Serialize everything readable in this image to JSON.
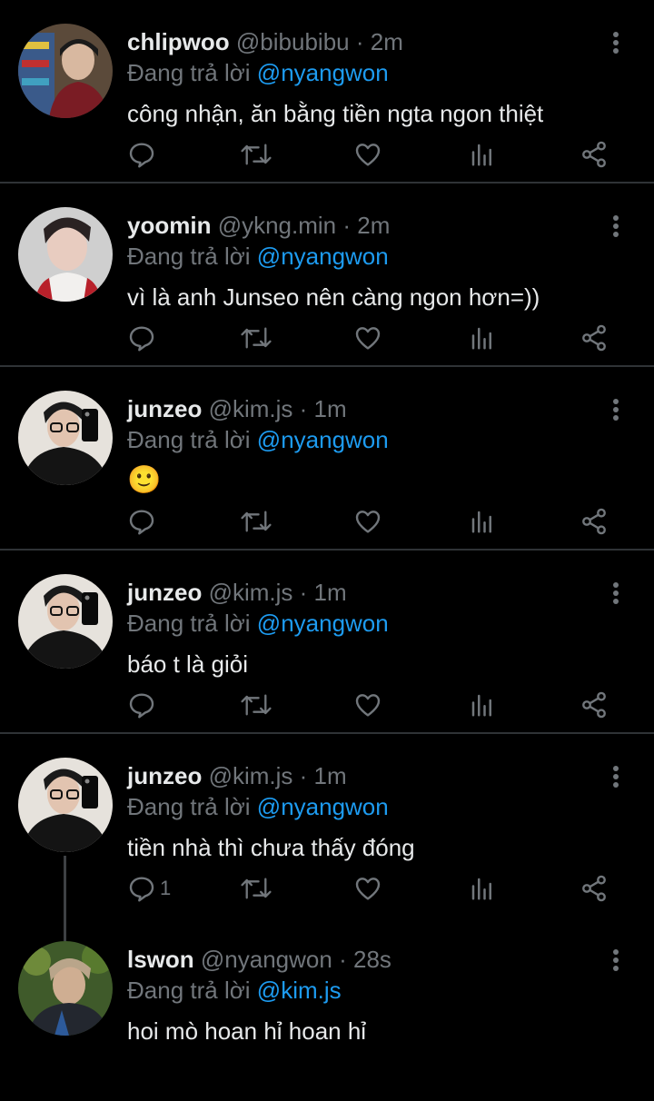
{
  "tweets": [
    {
      "name": "chlipwoo",
      "handle": "@bibubibu",
      "time": "2m",
      "reply_prefix": "Đang trả lời",
      "reply_to": "@nyangwon",
      "text": "công nhận, ăn bằng tiền ngta ngon thiệt",
      "reply_count": ""
    },
    {
      "name": "yoomin",
      "handle": "@ykng.min",
      "time": "2m",
      "reply_prefix": "Đang trả lời",
      "reply_to": "@nyangwon",
      "text": "vì là anh Junseo nên càng ngon hơn=))",
      "reply_count": ""
    },
    {
      "name": "junzeo",
      "handle": "@kim.js",
      "time": "1m",
      "reply_prefix": "Đang trả lời",
      "reply_to": "@nyangwon",
      "text": "🙂",
      "reply_count": ""
    },
    {
      "name": "junzeo",
      "handle": "@kim.js",
      "time": "1m",
      "reply_prefix": "Đang trả lời",
      "reply_to": "@nyangwon",
      "text": "báo t là giỏi",
      "reply_count": ""
    },
    {
      "name": "junzeo",
      "handle": "@kim.js",
      "time": "1m",
      "reply_prefix": "Đang trả lời",
      "reply_to": "@nyangwon",
      "text": "tiền nhà thì chưa thấy đóng",
      "reply_count": "1"
    },
    {
      "name": "lswon",
      "handle": "@nyangwon",
      "time": "28s",
      "reply_prefix": "Đang trả lời",
      "reply_to": "@kim.js",
      "text": "hoi mò hoan hỉ hoan hỉ",
      "reply_count": ""
    }
  ],
  "colors": {
    "background": "#000000",
    "text": "#e7e9ea",
    "muted": "#71767b",
    "accent": "#1d9bf0",
    "divider": "#2f3336"
  },
  "icons": {
    "reply": "comment-icon",
    "retweet": "retweet-icon",
    "like": "heart-icon",
    "views": "analytics-icon",
    "share": "share-icon",
    "menu": "more-vertical-icon"
  }
}
